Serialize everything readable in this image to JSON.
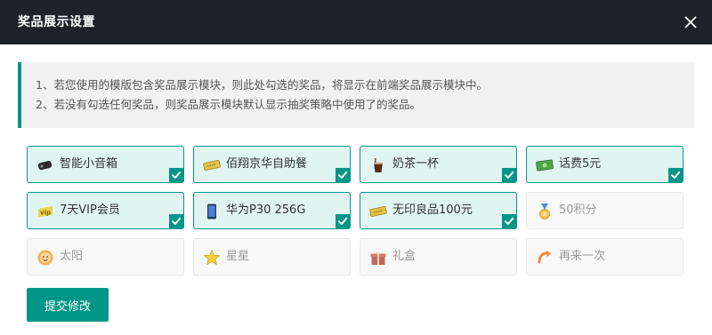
{
  "dialog": {
    "title": "奖品展示设置",
    "close_icon": "close-icon"
  },
  "notice": {
    "line1": "1、若您使用的模版包含奖品展示模块，则此处勾选的奖品，将显示在前端奖品展示模块中。",
    "line2": "2、若没有勾选任何奖品，则奖品展示模块默认显示抽奖策略中使用了的奖品。",
    "accent_color": "#009688"
  },
  "prizes": [
    {
      "name": "智能小音箱",
      "icon": "speaker-icon",
      "checked": true
    },
    {
      "name": "佰翔京华自助餐",
      "icon": "ticket-icon",
      "checked": true
    },
    {
      "name": "奶茶一杯",
      "icon": "milk-tea-icon",
      "checked": true
    },
    {
      "name": "话费5元",
      "icon": "money-icon",
      "checked": true
    },
    {
      "name": "7天VIP会员",
      "icon": "vip-icon",
      "checked": true
    },
    {
      "name": "华为P30 256G",
      "icon": "phone-icon",
      "checked": true
    },
    {
      "name": "无印良品100元",
      "icon": "ticket-icon",
      "checked": true
    },
    {
      "name": "50积分",
      "icon": "medal-icon",
      "checked": false
    },
    {
      "name": "太阳",
      "icon": "sun-icon",
      "checked": false
    },
    {
      "name": "星星",
      "icon": "star-icon",
      "checked": false
    },
    {
      "name": "礼盒",
      "icon": "gift-icon",
      "checked": false
    },
    {
      "name": "再来一次",
      "icon": "retry-icon",
      "checked": false
    }
  ],
  "submit_label": "提交修改",
  "colors": {
    "header_bg": "#1f222b",
    "primary": "#009688",
    "checked_bg": "#e0f5f2",
    "checked_border": "#0a9487"
  }
}
